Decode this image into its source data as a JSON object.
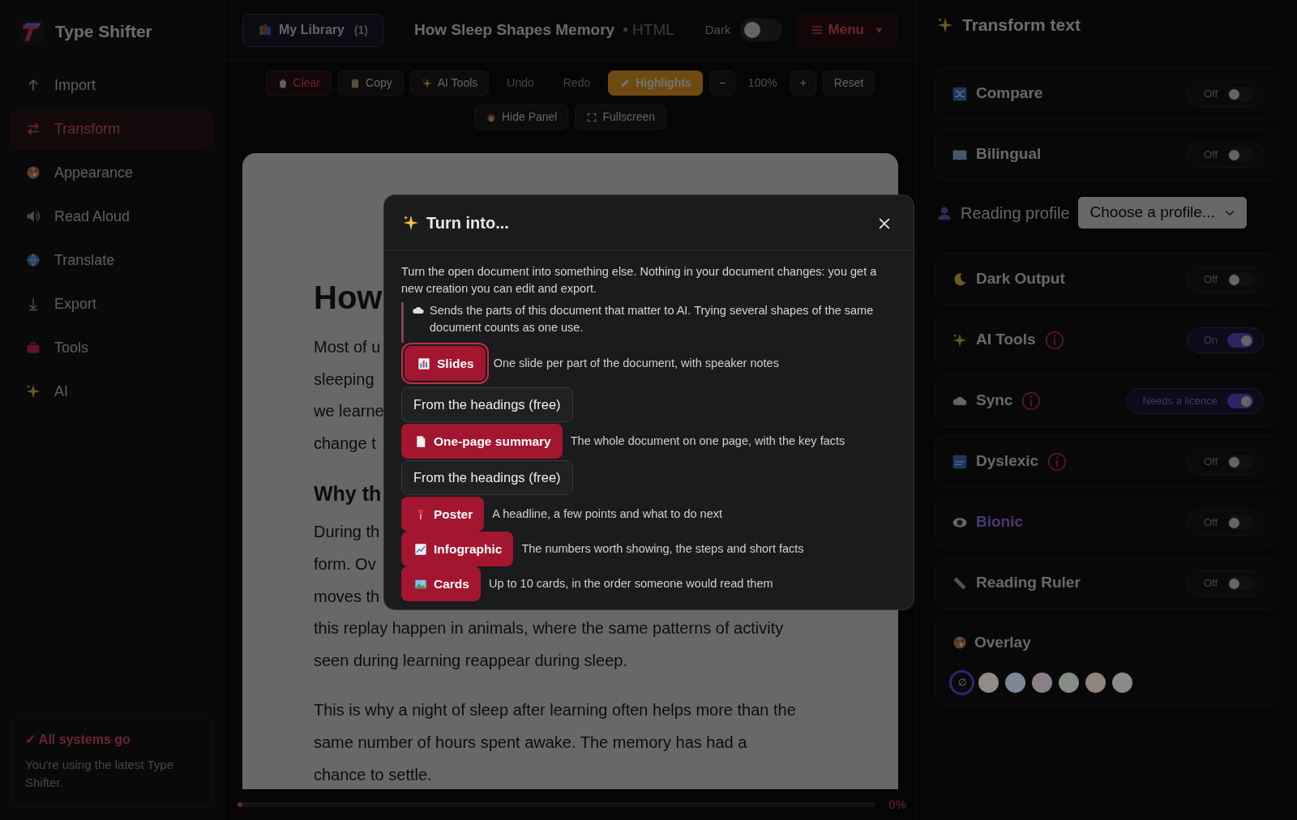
{
  "app": {
    "name": "Type Shifter"
  },
  "sidebar": {
    "items": [
      {
        "label": "Import",
        "selected": false
      },
      {
        "label": "Transform",
        "selected": true
      },
      {
        "label": "Appearance",
        "selected": false
      },
      {
        "label": "Read Aloud",
        "selected": false
      },
      {
        "label": "Translate",
        "selected": false
      },
      {
        "label": "Export",
        "selected": false
      },
      {
        "label": "Tools",
        "selected": false
      },
      {
        "label": "AI",
        "selected": false
      }
    ],
    "status": {
      "title": "✓ All systems go",
      "text": "You're using the latest Type Shifter."
    }
  },
  "header": {
    "library": {
      "label": "My Library",
      "count": "(1)"
    },
    "title": "How Sleep Shapes Memory",
    "format": "• HTML",
    "dark": {
      "label": "Dark",
      "on": false
    },
    "menu": "Menu"
  },
  "toolbar": {
    "buttons": [
      {
        "label": "Clear",
        "kind": "danger",
        "disabled": false,
        "active": false
      },
      {
        "label": "Copy",
        "kind": "plain",
        "disabled": false,
        "active": false
      },
      {
        "label": "AI Tools",
        "kind": "plain",
        "disabled": false,
        "active": false
      },
      {
        "label": "Undo",
        "kind": "plain",
        "disabled": true,
        "active": false
      },
      {
        "label": "Redo",
        "kind": "plain",
        "disabled": true,
        "active": false
      },
      {
        "label": "Highlights",
        "kind": "plain",
        "disabled": false,
        "active": true
      }
    ],
    "zoom_out": "−",
    "zoom": "100%",
    "zoom_in": "+",
    "reset": "Reset",
    "view_buttons": [
      "Hide Panel",
      "Fullscreen"
    ]
  },
  "document": {
    "blocks": [
      {
        "kind": "h1",
        "lines": [
          "How"
        ]
      },
      {
        "kind": "p",
        "lines": [
          "Most of u",
          "sleeping",
          "we learne",
          "change t"
        ]
      },
      {
        "kind": "h2",
        "lines": [
          "Why th"
        ]
      },
      {
        "kind": "p",
        "lines": [
          "During th",
          "form. Ov",
          "moves th",
          "this replay happen in animals, where the same patterns of activity",
          "seen during learning reappear during sleep."
        ]
      },
      {
        "kind": "p",
        "lines": [
          "This is why a night of sleep after learning often helps more than the",
          "same number of hours spent awake. The memory has had a",
          "chance to settle."
        ]
      }
    ]
  },
  "progress": {
    "level": 0,
    "reading": "0%"
  },
  "dialog": {
    "title": "Turn into...",
    "intro": "Turn the open document into something else. Nothing in your document changes: you get a new creation you can edit and export.",
    "note": "Sends the parts of this document that matter to AI. Trying several shapes of the same document counts as one use.",
    "options": [
      {
        "label": "Slides",
        "description": "One slide per part of the document, with speaker notes",
        "focused": true,
        "free": "From the headings (free)"
      },
      {
        "label": "One-page summary",
        "description": "The whole document on one page, with the key facts",
        "focused": false,
        "free": "From the headings (free)"
      },
      {
        "label": "Poster",
        "description": "A headline, a few points and what to do next",
        "focused": false
      },
      {
        "label": "Infographic",
        "description": "The numbers worth showing, the steps and short facts",
        "focused": false
      },
      {
        "label": "Cards",
        "description": "Up to 10 cards, in the order someone would read them",
        "focused": false
      }
    ]
  },
  "panel": {
    "title": "Transform text",
    "items": [
      {
        "kind": "toggle",
        "label": "Compare",
        "state": "Off",
        "on": false,
        "info": false,
        "accent": false
      },
      {
        "kind": "toggle",
        "label": "Bilingual",
        "state": "Off",
        "on": false,
        "info": false,
        "accent": false
      },
      {
        "kind": "select",
        "label": "Reading profile",
        "placeholder": "Choose a profile..."
      },
      {
        "kind": "toggle",
        "label": "Dark Output",
        "state": "Off",
        "on": false,
        "info": false,
        "accent": false
      },
      {
        "kind": "toggle",
        "label": "AI Tools",
        "state": "On",
        "on": true,
        "info": true,
        "accent": false
      },
      {
        "kind": "toggle",
        "label": "Sync",
        "state": "Needs a licence",
        "on": true,
        "info": true,
        "accent": false
      },
      {
        "kind": "toggle",
        "label": "Dyslexic",
        "state": "Off",
        "on": false,
        "info": true,
        "accent": false
      },
      {
        "kind": "toggle",
        "label": "Bionic",
        "state": "Off",
        "on": false,
        "info": false,
        "accent": true
      },
      {
        "kind": "toggle",
        "label": "Reading Ruler",
        "state": "Off",
        "on": false,
        "info": false,
        "accent": false
      },
      {
        "kind": "swatches",
        "label": "Overlay",
        "swatches": [
          {
            "label": "∅",
            "selected": true
          },
          {
            "color": "#908b85",
            "selected": false
          },
          {
            "color": "#7f8797",
            "selected": false
          },
          {
            "color": "#8c8088",
            "selected": false
          },
          {
            "color": "#848c83",
            "selected": false
          },
          {
            "color": "#8f857c",
            "selected": false
          },
          {
            "color": "#8a8a8a",
            "selected": false
          }
        ]
      }
    ]
  }
}
